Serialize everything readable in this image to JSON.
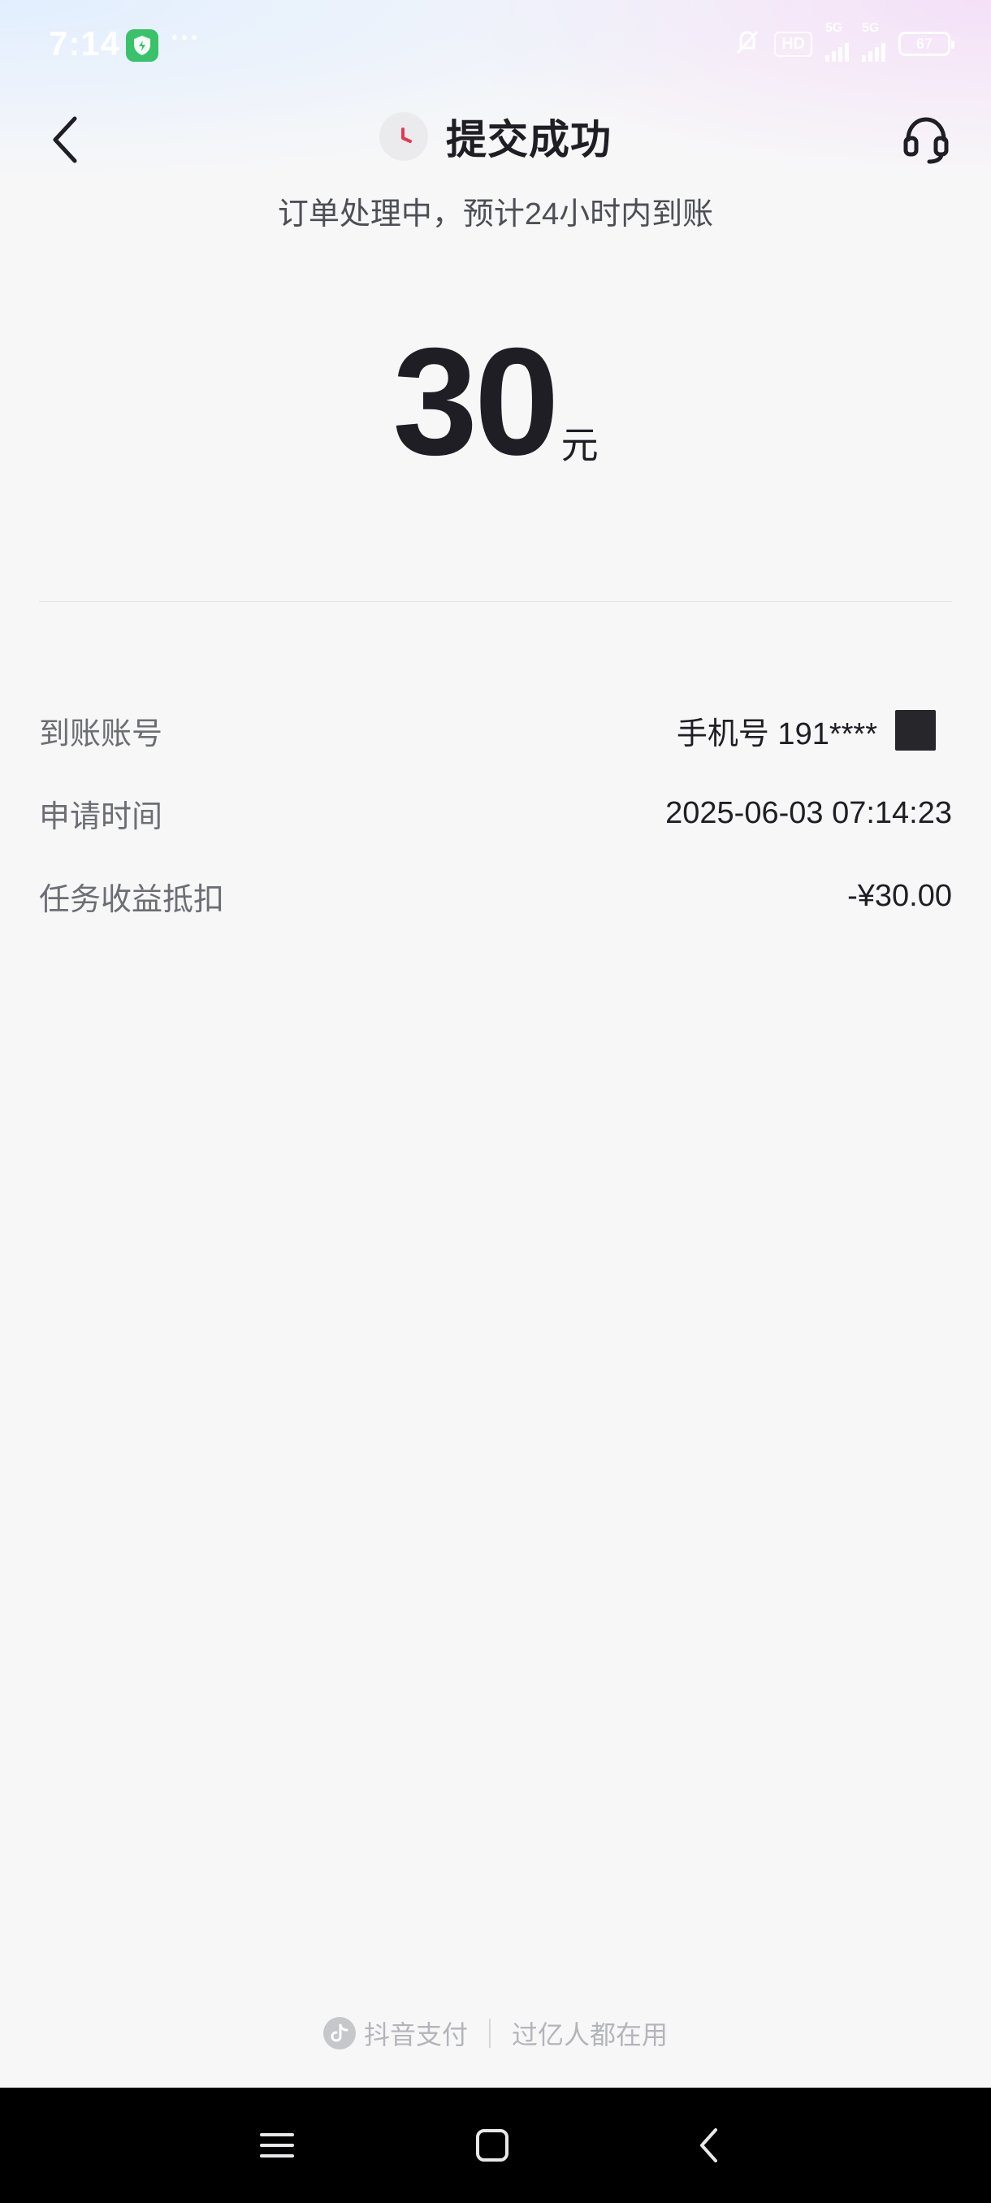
{
  "status_bar": {
    "time": "7:14",
    "network_badge": "HD",
    "signal_1_label": "5G",
    "signal_2_label": "5G",
    "battery": "67"
  },
  "header": {
    "title": "提交成功",
    "subtitle": "订单处理中，预计24小时内到账"
  },
  "amount": {
    "value": "30",
    "unit": "元"
  },
  "details": {
    "rows": [
      {
        "label": "到账账号",
        "value": "手机号 191****"
      },
      {
        "label": "申请时间",
        "value": "2025-06-03 07:14:23"
      },
      {
        "label": "任务收益抵扣",
        "value": "-¥30.00"
      }
    ]
  },
  "footer": {
    "brand": "抖音支付",
    "tagline": "过亿人都在用"
  },
  "colors": {
    "background": "#f7f7f8",
    "text_primary": "#1e1e24",
    "text_secondary": "#6c6e74",
    "clock_accent": "#e53950",
    "shield_green": "#3ac26a",
    "footer_text": "#b4b5ba"
  },
  "icons": {
    "back": "chevron-left-icon",
    "status": "clock-icon",
    "service": "headset-icon",
    "brand": "douyin-logo-icon",
    "nav_menu": "menu-icon",
    "nav_home": "home-icon",
    "nav_back": "back-icon"
  }
}
